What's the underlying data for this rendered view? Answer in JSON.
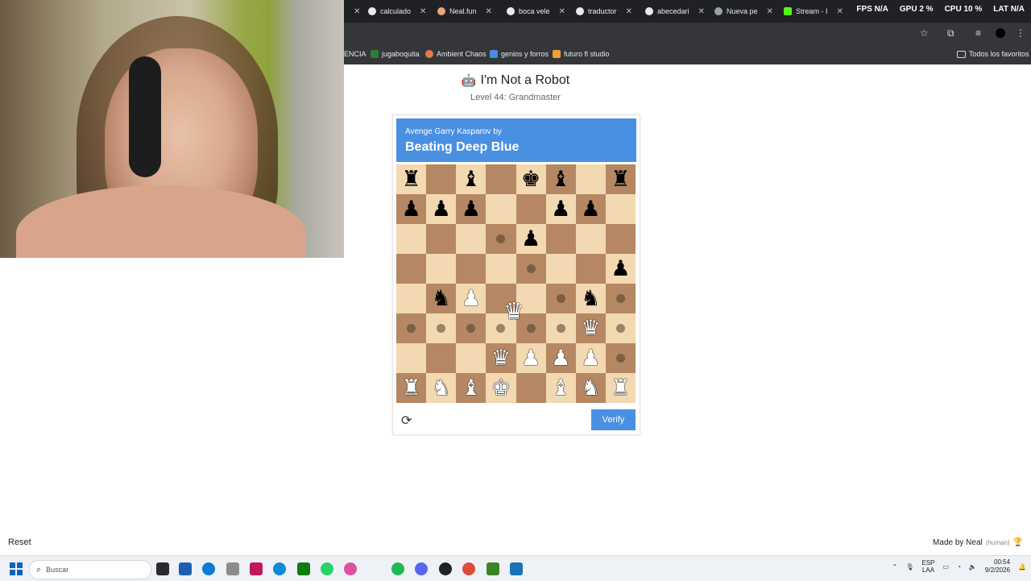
{
  "browser": {
    "tabs": [
      {
        "label": "calculado"
      },
      {
        "label": "Neal.fun"
      },
      {
        "label": "boca vele"
      },
      {
        "label": "traductor"
      },
      {
        "label": "abecedari"
      },
      {
        "label": "Nueva pe"
      },
      {
        "label": "Stream - I"
      }
    ],
    "stats": [
      {
        "label": "FPS",
        "value": "N/A"
      },
      {
        "label": "GPU",
        "value": "2 %"
      },
      {
        "label": "CPU",
        "value": "10 %"
      },
      {
        "label": "LAT",
        "value": "N/A"
      }
    ],
    "bookmarks": [
      {
        "label": "ENCIA"
      },
      {
        "label": "jugaboquita"
      },
      {
        "label": "Ambient Chaos"
      },
      {
        "label": "genios y forros"
      },
      {
        "label": "futuro fl studio"
      }
    ],
    "all_bookmarks": "Todos los favoritos"
  },
  "page": {
    "title": "I'm Not a Robot",
    "level": "Level 44: Grandmaster",
    "captcha_line1": "Avenge Garry Kasparov by",
    "captcha_line2": "Beating Deep Blue",
    "verify_label": "Verify",
    "reset_label": "Reset",
    "made_by": "Made by Neal",
    "made_by_note": "(human)"
  },
  "board": {
    "rows": [
      [
        "bR",
        "",
        "bB",
        "",
        "bK",
        "bB",
        "",
        "bR"
      ],
      [
        "bP",
        "bP",
        "bP",
        "",
        "",
        "bP",
        "bP",
        ""
      ],
      [
        "",
        "",
        "",
        "",
        "bP",
        "",
        "",
        ""
      ],
      [
        "",
        "",
        "",
        "",
        "",
        "",
        "",
        "bP"
      ],
      [
        "",
        "bN",
        "wP",
        "",
        "",
        "",
        "bN",
        ""
      ],
      [
        "",
        "",
        "",
        "",
        "",
        "",
        "wQ",
        ""
      ],
      [
        "",
        "",
        "",
        "wQ",
        "wP",
        "wP",
        "wP",
        ""
      ],
      [
        "wR",
        "wN",
        "wB",
        "wK",
        "",
        "wB",
        "wN",
        "wR"
      ]
    ],
    "hints": [
      [
        2,
        3
      ],
      [
        3,
        4
      ],
      [
        4,
        5
      ],
      [
        4,
        7
      ],
      [
        5,
        0
      ],
      [
        5,
        1
      ],
      [
        5,
        2
      ],
      [
        5,
        3
      ],
      [
        5,
        4
      ],
      [
        5,
        5
      ],
      [
        5,
        7
      ],
      [
        6,
        7
      ]
    ],
    "dragged_piece": "wQ"
  },
  "taskbar": {
    "search_placeholder": "Buscar",
    "lang_top": "ESP",
    "lang_bottom": "LAA",
    "time": "00:54",
    "date": "9/2/2026"
  }
}
